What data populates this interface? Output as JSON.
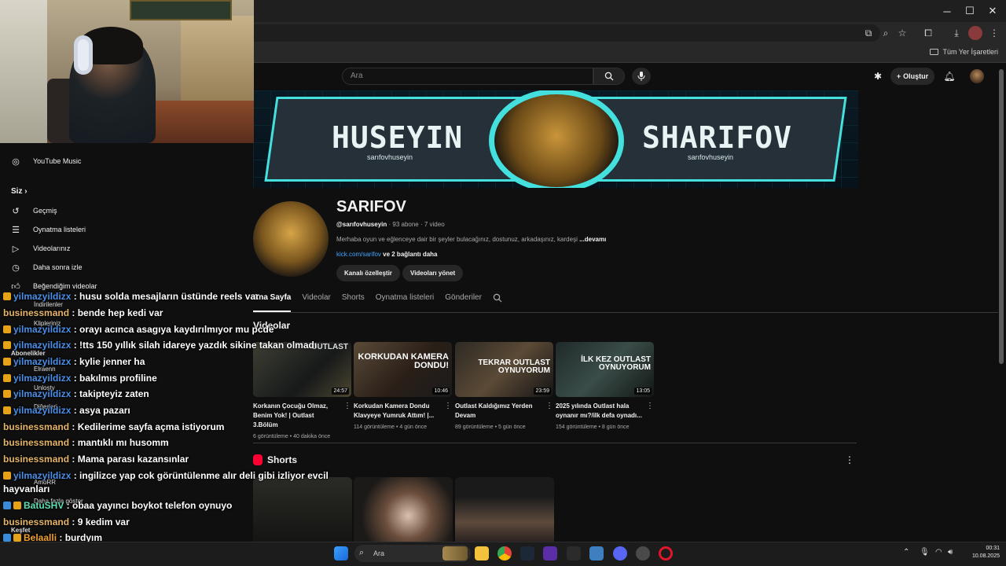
{
  "browser": {
    "bookmarks_all": "Tüm Yer İşaretleri",
    "window_controls": [
      "─",
      "☐",
      "✕"
    ]
  },
  "masthead": {
    "search_placeholder": "Ara",
    "create_label": "Oluştur"
  },
  "banner": {
    "name_left": "HUSEYIN",
    "name_right": "SHARIFOV",
    "handle_left": "sarıfovhuseyin",
    "handle_right": "sarıfovhuseyin",
    "accent_color": "#43e0dd"
  },
  "channel": {
    "name": "SARIFOV",
    "handle": "@sarıfovhuseyin",
    "subscribers": "93 abone",
    "videos": "7 video",
    "description": "Merhaba oyun ve eğlenceye dair bir şeyler bulacağınız, dostunuz, arkadaşınız, kardeşi",
    "more": "...devamı",
    "link": "kick.com/sarifov",
    "link_more": "ve 2 bağlantı daha",
    "customize_button": "Kanalı özelleştir",
    "manage_button": "Videoları yönet"
  },
  "tabs": [
    "Ana Sayfa",
    "Videolar",
    "Shorts",
    "Oynatma listeleri",
    "Gönderiler"
  ],
  "videos_section": {
    "title": "Videolar",
    "items": [
      {
        "title": "Korkanın Çocuğu Olmaz, Benim Yok! | Outlast 3.Bölüm",
        "views": "6 görüntüleme",
        "age": "40 dakika önce",
        "duration": "24:57",
        "overlay": "OUTLAST"
      },
      {
        "title": "Korkudan Kamera Dondu Klavyeye Yumruk Attım! |...",
        "views": "114 görüntüleme",
        "age": "4 gün önce",
        "duration": "10:46",
        "overlay": "KORKUDAN KAMERA DONDU!"
      },
      {
        "title": "Outlast Kaldığımız Yerden Devam",
        "views": "89 görüntüleme",
        "age": "5 gün önce",
        "duration": "23:59",
        "overlay": "TEKRAR OUTLAST OYNUYORUM"
      },
      {
        "title": "2025 yılında Outlast hala oynanır mı?/ilk defa oynadı...",
        "views": "154 görüntüleme",
        "age": "8 gün önce",
        "duration": "13:05",
        "overlay": "İLK KEZ OUTLAST OYNUYORUM"
      }
    ]
  },
  "shorts_section": {
    "title": "Shorts"
  },
  "sidebar": {
    "items": [
      {
        "label": "YouTube Music",
        "icon": "youtube-music-icon"
      },
      {
        "label": "Geçmiş",
        "icon": "history-icon"
      },
      {
        "label": "Oynatma listeleri",
        "icon": "playlists-icon"
      },
      {
        "label": "Videolarınız",
        "icon": "your-videos-icon"
      },
      {
        "label": "Daha sonra izle",
        "icon": "watch-later-icon"
      },
      {
        "label": "Beğendiğim videolar",
        "icon": "liked-icon"
      }
    ],
    "section_you": "Siz",
    "ghost_items": [
      "İndirilenler",
      "Klipleriniz",
      "Abonelikler",
      "Elraenn",
      "Unlosty",
      "Diğerleri",
      "AmoRR",
      "Daha fazla göster",
      "Keşfet"
    ]
  },
  "chat": [
    {
      "user": "yilmazyildizx",
      "msg": "husu solda mesajların üstünde reels var",
      "color": "y"
    },
    {
      "user": "businessmand",
      "msg": "bende hep kedi var",
      "color": "b"
    },
    {
      "user": "yilmazyildizx",
      "msg": "orayı acınca asagıya kaydırılmıyor mu pcde",
      "color": "y"
    },
    {
      "user": "yilmazyildizx",
      "msg": "!tts 150 yıllık silah idareye yazdık sikine takan olmadı",
      "color": "y"
    },
    {
      "user": "yilmazyildizx",
      "msg": "kylie jenner ha",
      "color": "y"
    },
    {
      "user": "yilmazyildizx",
      "msg": "bakılmıs profiline",
      "color": "y"
    },
    {
      "user": "yilmazyildizx",
      "msg": "takipteyiz zaten",
      "color": "y"
    },
    {
      "user": "yilmazyildizx",
      "msg": "asya pazarı",
      "color": "y"
    },
    {
      "user": "businessmand",
      "msg": "Kedilerime sayfa açma istiyorum",
      "color": "b"
    },
    {
      "user": "businessmand",
      "msg": "mantıklı mı husomm",
      "color": "b"
    },
    {
      "user": "businessmand",
      "msg": "Mama parası kazansınlar",
      "color": "b"
    },
    {
      "user": "yilmazyildizx",
      "msg": "ingilizce yap cok görüntülenme alır deli gibi izliyor evcil",
      "color": "y"
    },
    {
      "user": "",
      "msg": "hayvanları",
      "color": "y"
    },
    {
      "user": "BatuSHV",
      "msg": "obaa yayıncı boykot telefon oynuyo",
      "color": "g"
    },
    {
      "user": "businessmand",
      "msg": "9 kedim var",
      "color": "b"
    },
    {
      "user": "Belaalli",
      "msg": "burdyım",
      "color": "o"
    }
  ],
  "taskbar": {
    "search_placeholder": "Ara",
    "time": "00:31",
    "date": "10.08.2025"
  }
}
